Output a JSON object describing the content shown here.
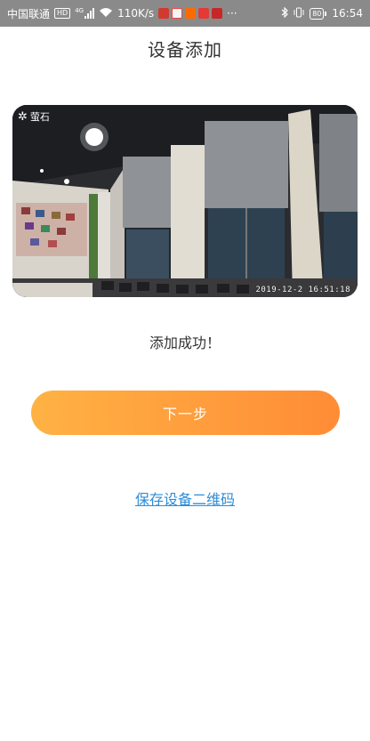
{
  "status_bar": {
    "carrier": "中国联通",
    "network_badge": "HD",
    "network_type": "4G",
    "speed": "110K/s",
    "more": "···",
    "battery": "80",
    "time": "16:54",
    "icons": [
      "hd-icon",
      "signal-icon",
      "wifi-icon",
      "app-notification-icons",
      "bluetooth-icon",
      "vibrate-icon",
      "battery-icon"
    ]
  },
  "header": {
    "title": "设备添加"
  },
  "camera": {
    "brand": "萤石",
    "timestamp": "2019-12-2  16:51:18"
  },
  "result": {
    "message": "添加成功！"
  },
  "actions": {
    "next_label": "下一步",
    "save_qr_label": "保存设备二维码"
  },
  "colors": {
    "button_start": "#ffb244",
    "button_end": "#ff8c36",
    "link": "#2d8dd8",
    "status_bar": "#8a8a8a"
  }
}
